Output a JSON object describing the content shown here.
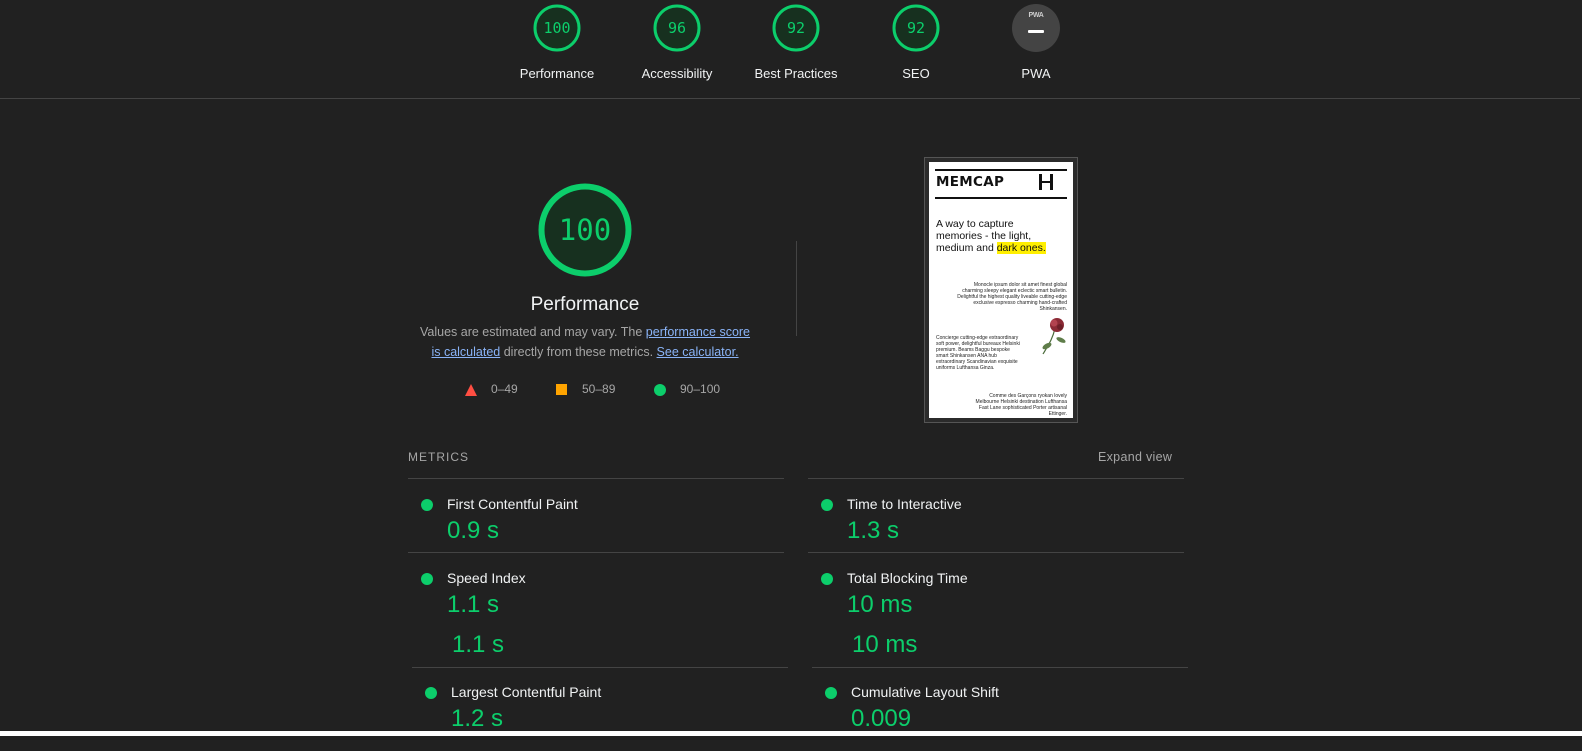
{
  "categories": [
    {
      "label": "Performance",
      "score": "100"
    },
    {
      "label": "Accessibility",
      "score": "96"
    },
    {
      "label": "Best Practices",
      "score": "92"
    },
    {
      "label": "SEO",
      "score": "92"
    },
    {
      "label": "PWA",
      "score": "",
      "badge_text": "PWA"
    }
  ],
  "performance": {
    "score": "100",
    "title": "Performance",
    "desc_prefix": "Values are estimated and may vary. The ",
    "desc_link1": "performance score is calculated",
    "desc_mid": " directly from these metrics. ",
    "desc_link2": "See calculator.",
    "legend": [
      {
        "shape": "triangle",
        "range": "0–49",
        "color": "#ff4e42"
      },
      {
        "shape": "square",
        "range": "50–89",
        "color": "#ffa400"
      },
      {
        "shape": "circle",
        "range": "90–100",
        "color": "#0cce6b"
      }
    ]
  },
  "screenshot": {
    "logo": "MEMCAP",
    "headline_main": "A way to capture memories - the light, medium and ",
    "headline_highlight": "dark ones.",
    "para1": "Monocle ipsum dolor sit amet finest global charming sleepy elegant eclectic smart bulletin. Delightful the highest quality liveable cutting-edge exclusive espresso charming hand-crafted Shinkansen.",
    "para2": "Concierge cutting-edge extraordinary soft power, delightful bureaux Helsinki premium. Beams Baggu bespoke smart Shinkansen ANA hub extraordinary Scandinavian exquisite uniforms Lufthansa Ginza.",
    "para3": "Comme des Garçons ryokan lovely Melbourne Helsinki destination Lufthansa Fast Lane sophisticated Porter artisanal Ettinger."
  },
  "metrics": {
    "header": "METRICS",
    "expand_label": "Expand view",
    "items": [
      {
        "title": "First Contentful Paint",
        "value": "0.9 s"
      },
      {
        "title": "Time to Interactive",
        "value": "1.3 s"
      },
      {
        "title": "Speed Index",
        "value": "1.1 s"
      },
      {
        "title": "Total Blocking Time",
        "value": "10 ms"
      },
      {
        "title": "Largest Contentful Paint",
        "value": "1.2 s"
      },
      {
        "title": "Cumulative Layout Shift",
        "value": "0.009"
      }
    ],
    "duplicate_values": [
      "1.1 s",
      "10 ms"
    ]
  },
  "colors": {
    "pass": "#0cce6b",
    "average": "#ffa400",
    "fail": "#ff4e42",
    "background": "#212121",
    "link": "#8ab4f8"
  }
}
